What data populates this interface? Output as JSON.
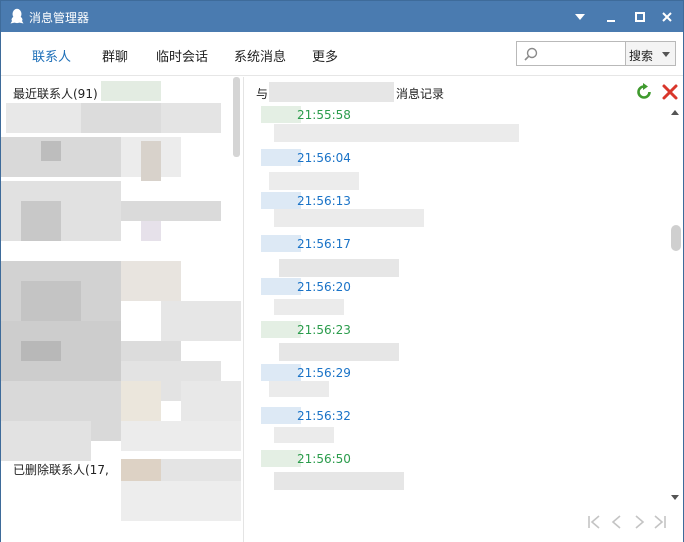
{
  "window": {
    "title": "消息管理器",
    "icon": "qq-penguin-icon",
    "controls": [
      "chevron-down-icon",
      "minimize-icon",
      "maximize-icon",
      "close-icon"
    ]
  },
  "nav": {
    "tabs": [
      {
        "label": "联系人",
        "active": true
      },
      {
        "label": "群聊",
        "active": false
      },
      {
        "label": "临时会话",
        "active": false
      },
      {
        "label": "系统消息",
        "active": false
      },
      {
        "label": "更多",
        "active": false
      }
    ]
  },
  "search": {
    "placeholder": "",
    "button_label": "搜索"
  },
  "left": {
    "recent_header": "最近联系人(91)",
    "deleted_header": "已删除联系人(17,"
  },
  "history": {
    "title_prefix": "与",
    "title_suffix": "消息记录",
    "refresh_icon": "refresh-icon",
    "delete_icon": "delete-icon",
    "entries": [
      {
        "time": "21:55:58",
        "color": "green"
      },
      {
        "time": "21:56:04",
        "color": "blue"
      },
      {
        "time": "21:56:13",
        "color": "blue"
      },
      {
        "time": "21:56:17",
        "color": "blue"
      },
      {
        "time": "21:56:20",
        "color": "blue"
      },
      {
        "time": "21:56:23",
        "color": "green"
      },
      {
        "time": "21:56:29",
        "color": "blue"
      },
      {
        "time": "21:56:32",
        "color": "blue"
      },
      {
        "time": "21:56:50",
        "color": "green"
      }
    ]
  },
  "pager": {
    "icons": [
      "first-page-icon",
      "prev-page-icon",
      "next-page-icon",
      "last-page-icon"
    ]
  },
  "colors": {
    "titlebar": "#4a7bb0",
    "active_tab": "#1d6fb8",
    "time_blue": "#1a73c7",
    "time_green": "#2b9c4c"
  }
}
